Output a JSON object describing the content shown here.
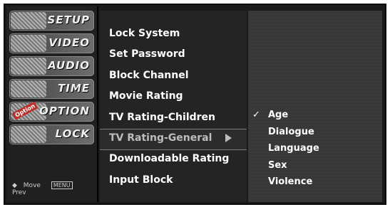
{
  "nav": {
    "tabs": [
      {
        "label": "SETUP",
        "icon": "setup-icon"
      },
      {
        "label": "VIDEO",
        "icon": "video-icon"
      },
      {
        "label": "AUDIO",
        "icon": "audio-icon"
      },
      {
        "label": "TIME",
        "icon": "time-icon"
      },
      {
        "label": "OPTION",
        "icon": "option-icon",
        "badge": "Option"
      },
      {
        "label": "LOCK",
        "icon": "lock-icon"
      }
    ],
    "footer": {
      "move_key": "◆",
      "move_label": "Move",
      "prev_key": "MENU",
      "prev_label": "Prev"
    }
  },
  "menu": {
    "items": [
      "Lock System",
      "Set Password",
      "Block Channel",
      "Movie Rating",
      "TV Rating-Children",
      "TV Rating-General",
      "Downloadable Rating",
      "Input Block"
    ],
    "selected_index": 5
  },
  "submenu": {
    "items": [
      "Age",
      "Dialogue",
      "Language",
      "Sex",
      "Violence"
    ],
    "checked_mark": "✓",
    "checked_index": 0
  }
}
